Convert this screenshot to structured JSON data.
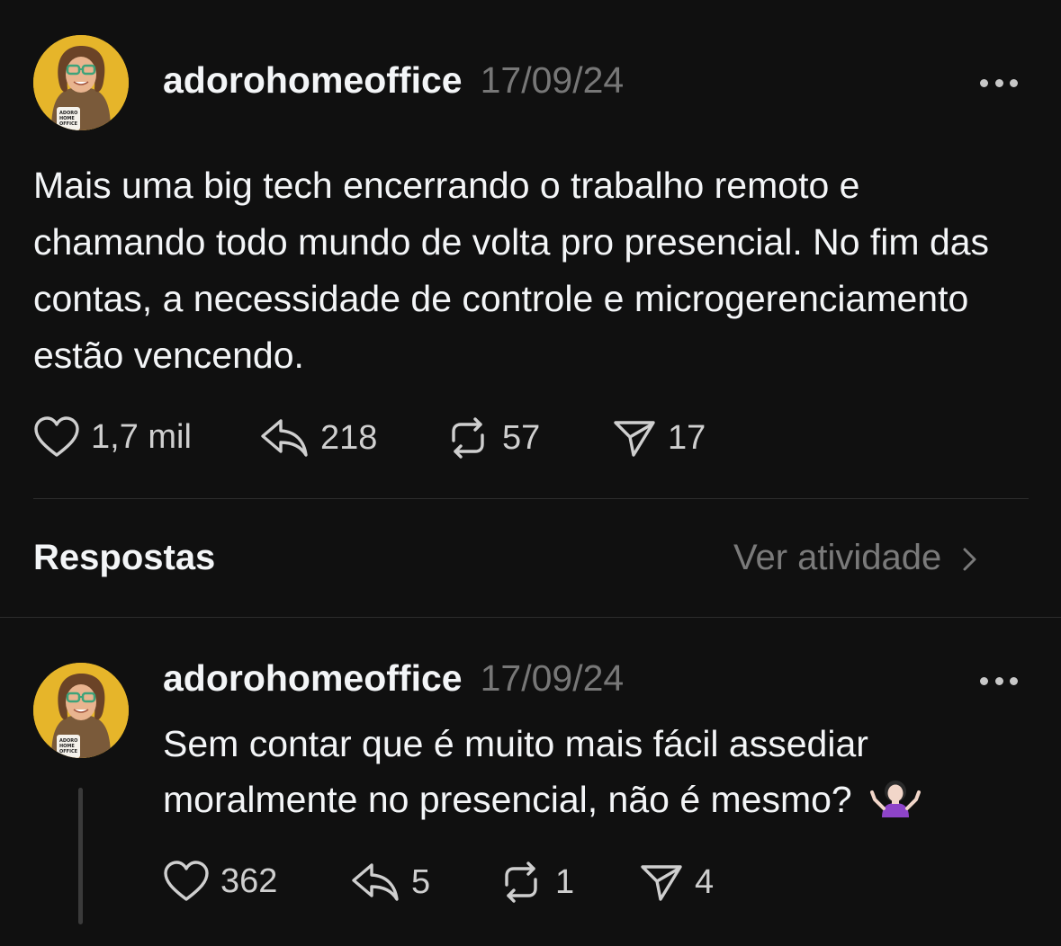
{
  "post": {
    "username": "adorohomeoffice",
    "date": "17/09/24",
    "text": "Mais uma big tech encerrando o trabalho remoto e chamando todo mundo de volta pro presencial. No fim das contas, a necessidade de controle e microgerenciamento estão vencendo.",
    "mug_text": "ADORO HOME OFFICE",
    "likes": "1,7 mil",
    "replies": "218",
    "reposts": "57",
    "shares": "17"
  },
  "replies_section": {
    "title": "Respostas",
    "activity_link": "Ver atividade"
  },
  "reply": {
    "username": "adorohomeoffice",
    "date": "17/09/24",
    "text": "Sem contar que é muito mais fácil assediar moralmente no presencial, não é mesmo?",
    "emoji": "person-shrugging",
    "mug_text": "ADORO HOME OFFICE",
    "likes": "362",
    "replies": "5",
    "reposts": "1",
    "shares": "4"
  },
  "colors": {
    "background": "#101010",
    "text_primary": "#f3f5f7",
    "text_secondary": "#777777",
    "avatar_bg": "#e6b52a"
  }
}
